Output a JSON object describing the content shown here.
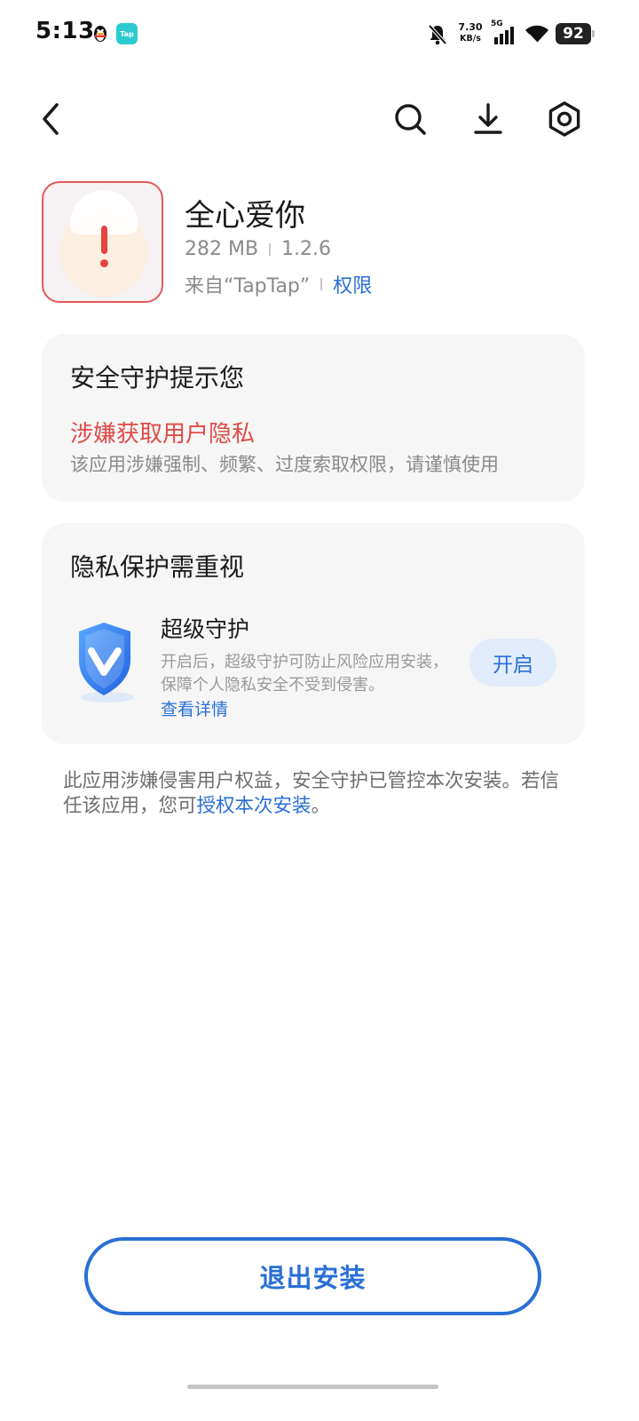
{
  "status_bar": {
    "time": "5:13",
    "tap_icon_text": "Tap",
    "net_speed_value": "7.30",
    "net_speed_unit": "KB/s",
    "network_type": "5G",
    "battery": "92"
  },
  "nav": {
    "back_icon": "chevron-left-icon",
    "search_icon": "search-icon",
    "download_icon": "download-icon",
    "settings_icon": "hexagon-gear-icon"
  },
  "app": {
    "name": "全心爱你",
    "size": "282 MB",
    "version": "1.2.6",
    "source": "来自“TapTap”",
    "permissions_link": "权限"
  },
  "security_card": {
    "title": "安全守护提示您",
    "warning_title": "涉嫌获取用户隐私",
    "warning_desc": "该应用涉嫌强制、频繁、过度索取权限，请谨慎使用"
  },
  "privacy_card": {
    "title": "隐私保护需重视",
    "feature_title": "超级守护",
    "feature_desc": "开启后，超级守护可防止风险应用安装，保障个人隐私安全不受到侵害。",
    "details_link": "查看详情",
    "enable_button": "开启"
  },
  "notice": {
    "text_part1": "此应用涉嫌侵害用户权益，安全守护已管控本次安装。若信任该应用，您可",
    "link": "授权本次安装",
    "text_part2": "。"
  },
  "exit_button": "退出安装",
  "colors": {
    "accent": "#2a6fd6",
    "warning": "#e04b46",
    "card_bg": "#f6f6f6"
  }
}
